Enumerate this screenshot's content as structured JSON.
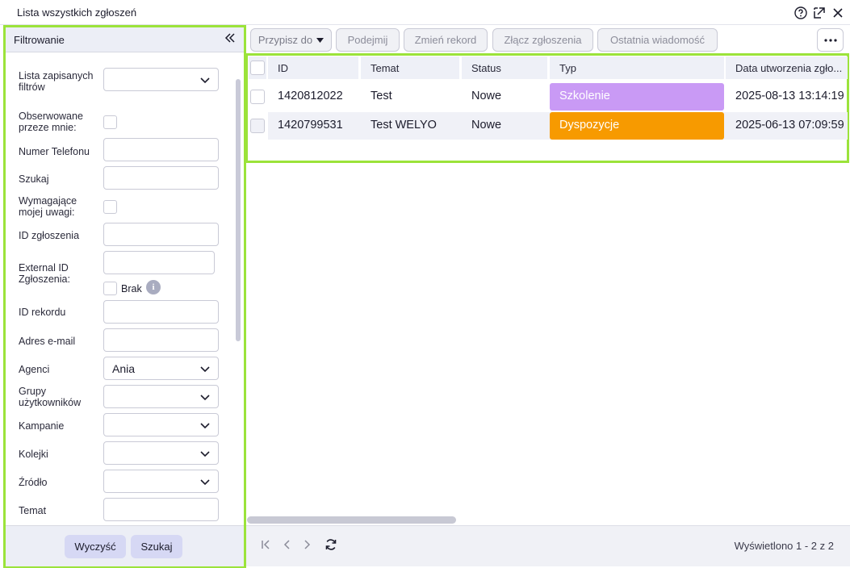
{
  "window": {
    "title": "Lista wszystkich zgłoszeń",
    "icons": [
      "help-icon",
      "popout-icon",
      "close-icon"
    ]
  },
  "filter": {
    "title": "Filtrowanie",
    "collapse_icon": "double-chevron-left-icon",
    "saved_filters_label": "Lista zapisanych filtrów",
    "observed_label": "Obserwowane przeze mnie:",
    "phone_label": "Numer Telefonu",
    "search_label": "Szukaj",
    "attention_label": "Wymagające mojej uwagi:",
    "ticket_id_label": "ID zgłoszenia",
    "external_id_label": "External ID Zgłoszenia:",
    "missing_label": "Brak",
    "record_id_label": "ID rekordu",
    "email_label": "Adres e-mail",
    "agents_label": "Agenci",
    "agents_value": "Ania",
    "user_groups_label": "Grupy użytkowników",
    "campaigns_label": "Kampanie",
    "queues_label": "Kolejki",
    "source_label": "Źródło",
    "subject_label": "Temat",
    "clear_button": "Wyczyść",
    "search_button": "Szukaj"
  },
  "toolbar": {
    "assign": "Przypisz do",
    "take": "Podejmij",
    "change_record": "Zmień rekord",
    "merge": "Złącz zgłoszenia",
    "last_message": "Ostatnia wiadomość"
  },
  "grid": {
    "headers": [
      "ID",
      "Temat",
      "Status",
      "Typ",
      "Data utworzenia zgło..."
    ],
    "rows": [
      {
        "id": "1420812022",
        "subject": "Test",
        "status": "Nowe",
        "type": "Szkolenie",
        "type_color": "#c99af5",
        "created": "2025-08-13 13:14:19"
      },
      {
        "id": "1420799531",
        "subject": "Test WELYO",
        "status": "Nowe",
        "type": "Dyspozycje",
        "type_color": "#f79a00",
        "created": "2025-06-13 07:09:59"
      }
    ]
  },
  "footer": {
    "shown": "Wyświetlono 1 - 2 z 2"
  },
  "colors": {
    "highlight": "#9be33a",
    "button": "#d6d8f4"
  }
}
